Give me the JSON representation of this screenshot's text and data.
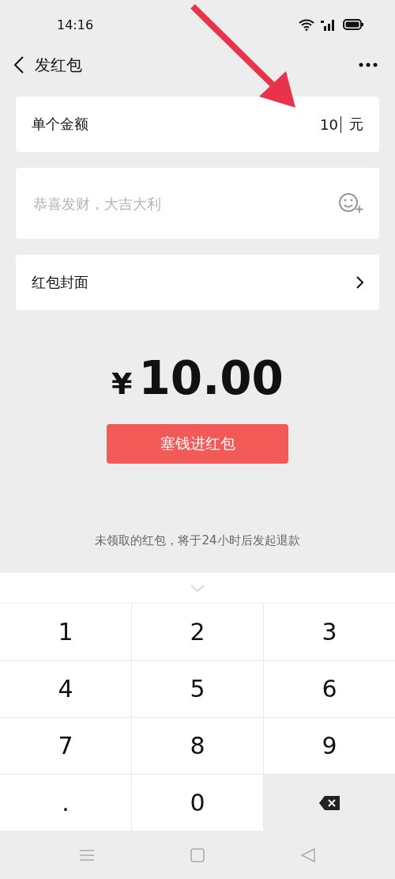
{
  "status_bar": {
    "time": "14:16"
  },
  "nav": {
    "title": "发红包"
  },
  "amount_field": {
    "label": "单个金额",
    "value": "10",
    "unit": "元"
  },
  "greeting_field": {
    "placeholder": "恭喜发财，大吉大利"
  },
  "cover_row": {
    "label": "红包封面"
  },
  "total": {
    "currency": "¥",
    "amount": "10.00"
  },
  "submit_button": {
    "label": "塞钱进红包"
  },
  "notice": "未领取的红包，将于24小时后发起退款",
  "keypad": [
    {
      "kind": "digit",
      "label": "1"
    },
    {
      "kind": "digit",
      "label": "2"
    },
    {
      "kind": "digit",
      "label": "3"
    },
    {
      "kind": "digit",
      "label": "4"
    },
    {
      "kind": "digit",
      "label": "5"
    },
    {
      "kind": "digit",
      "label": "6"
    },
    {
      "kind": "digit",
      "label": "7"
    },
    {
      "kind": "digit",
      "label": "8"
    },
    {
      "kind": "digit",
      "label": "9"
    },
    {
      "kind": "digit",
      "label": "."
    },
    {
      "kind": "digit",
      "label": "0"
    },
    {
      "kind": "delete"
    }
  ],
  "annotation": {
    "kind": "arrow"
  }
}
